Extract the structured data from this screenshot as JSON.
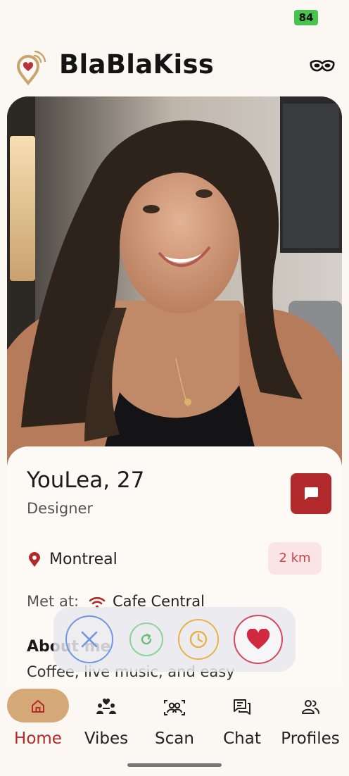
{
  "status_bar": {
    "battery": "84"
  },
  "header": {
    "app_name": "BlaBlaKiss",
    "logo_icon": "heart-location-pin-icon",
    "mask_icon": "mask-icon"
  },
  "profile": {
    "name_age": "YouLea, 27",
    "occupation": "Designer",
    "city": "Montreal",
    "distance": "2 km",
    "met_at_label": "Met at:",
    "met_place": "Cafe Central",
    "about_title": "About me",
    "about_text": "Coffee, live music, and easy"
  },
  "actions": [
    {
      "name": "pass",
      "icon": "close-icon",
      "color": "#6f97e0"
    },
    {
      "name": "rewind",
      "icon": "refresh-icon",
      "color": "#8fd39a"
    },
    {
      "name": "later",
      "icon": "clock-icon",
      "color": "#e8b24a"
    },
    {
      "name": "like",
      "icon": "heart-icon",
      "color": "#d24a59"
    }
  ],
  "tabs": [
    {
      "label": "Home",
      "icon": "home-icon",
      "active": true
    },
    {
      "label": "Vibes",
      "icon": "vibes-icon",
      "active": false
    },
    {
      "label": "Scan",
      "icon": "scan-people-icon",
      "active": false
    },
    {
      "label": "Chat",
      "icon": "chat-icon",
      "active": false
    },
    {
      "label": "Profiles",
      "icon": "profiles-icon",
      "active": false
    }
  ],
  "colors": {
    "accent": "#b1292b",
    "active_tab": "#d4a977",
    "background": "#fbf8f3"
  }
}
